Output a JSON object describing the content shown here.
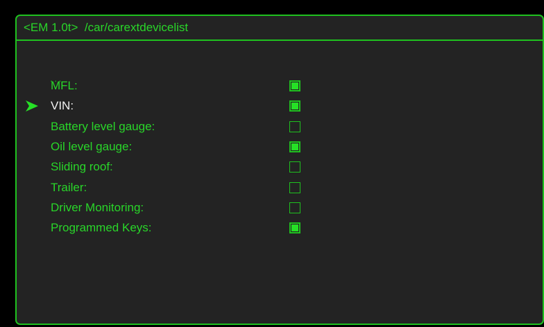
{
  "header": {
    "title": "<EM 1.0t>  /car/carextdevicelist"
  },
  "list": {
    "ellipsis": "...",
    "items": [
      {
        "label": "MFL:",
        "checked": true,
        "selected": false
      },
      {
        "label": "VIN:",
        "checked": true,
        "selected": true
      },
      {
        "label": "Battery level gauge:",
        "checked": false,
        "selected": false
      },
      {
        "label": "Oil level gauge:",
        "checked": true,
        "selected": false
      },
      {
        "label": "Sliding roof:",
        "checked": false,
        "selected": false
      },
      {
        "label": "Trailer:",
        "checked": false,
        "selected": false
      },
      {
        "label": "Driver Monitoring:",
        "checked": false,
        "selected": false
      },
      {
        "label": "Programmed Keys:",
        "checked": true,
        "selected": false
      }
    ]
  },
  "colors": {
    "accent": "#1fc21f",
    "text": "#29d629",
    "selected_text": "#f2f2f2",
    "panel_background": "#232323"
  },
  "icons": {
    "cursor": "arrow-right-icon"
  }
}
